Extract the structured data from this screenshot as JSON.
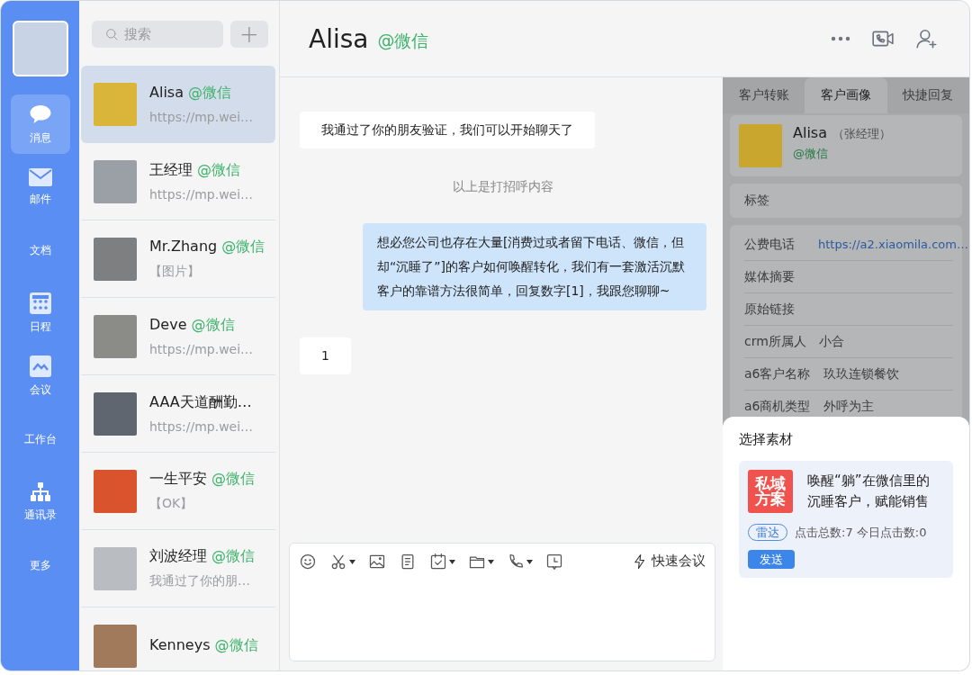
{
  "sidebar": {
    "items": [
      {
        "kind": "chat",
        "label": "消息",
        "selected": true
      },
      {
        "kind": "mail",
        "label": "邮件",
        "selected": false
      },
      {
        "kind": "text",
        "label": "文档",
        "selected": false
      },
      {
        "kind": "calendar",
        "label": "日程",
        "selected": false
      },
      {
        "kind": "gallery",
        "label": "会议",
        "selected": false
      },
      {
        "kind": "text",
        "label": "工作台",
        "selected": false
      },
      {
        "kind": "org",
        "label": "通讯录",
        "selected": false
      },
      {
        "kind": "text",
        "label": "更多",
        "selected": false
      }
    ]
  },
  "search": {
    "placeholder": "搜索"
  },
  "add_button": "+",
  "contacts": [
    {
      "name": "Alisa",
      "tag": "@微信",
      "preview": "https://mp.wei…",
      "selected": true
    },
    {
      "name": "王经理",
      "tag": "@微信",
      "preview": "https://mp.wei…",
      "selected": false
    },
    {
      "name": "Mr.Zhang",
      "tag": "@微信",
      "preview": "【图片】",
      "selected": false
    },
    {
      "name": "Deve",
      "tag": "@微信",
      "preview": "https://mp.wei…",
      "selected": false
    },
    {
      "name": "AAA天道酬勤…",
      "preview": "https://mp.wei…",
      "selected": false
    },
    {
      "name": "一生平安",
      "tag": "@微信",
      "preview": "【OK】",
      "selected": false
    },
    {
      "name": "刘波经理",
      "tag": "@微信",
      "preview": "我通过了你的朋…",
      "selected": false
    },
    {
      "name": "Kenneys",
      "tag": "@微信",
      "selected": false
    }
  ],
  "chat": {
    "title": "Alisa",
    "tag": "@微信",
    "messages": [
      {
        "kind": "incoming",
        "text": "我通过了你的朋友验证，我们可以开始聊天了"
      },
      {
        "kind": "system",
        "text": "以上是打招呼内容"
      },
      {
        "kind": "outgoing",
        "text": "想必您公司也存在大量[消费过或者留下电话、微信，但却“沉睡了”]的客户如何唤醒转化，我们有一套激活沉默客户的靠谱方法很简单，回复数字[1]，我跟您聊聊~"
      },
      {
        "kind": "incoming",
        "text": "1"
      }
    ],
    "toolbar": [
      {
        "kind": "emoji",
        "menu": false
      },
      {
        "kind": "scissors",
        "menu": true
      },
      {
        "kind": "image",
        "menu": false
      },
      {
        "kind": "document",
        "menu": false
      },
      {
        "kind": "task",
        "menu": true
      },
      {
        "kind": "folder",
        "menu": true
      },
      {
        "kind": "phone",
        "menu": true
      },
      {
        "kind": "clock",
        "menu": false
      }
    ],
    "quick_meeting": "快速会议"
  },
  "panel": {
    "tabs": [
      {
        "label": "客户转账",
        "selected": false
      },
      {
        "label": "客户画像",
        "selected": true
      },
      {
        "label": "快捷回复",
        "selected": false
      }
    ],
    "profile": {
      "name": "Alisa",
      "note": "（张经理）",
      "tag": "@微信"
    },
    "tags_label": "标签",
    "fields": [
      {
        "label": "公费电话",
        "value": "https://a2.xiaomila.com…",
        "kind": "link"
      },
      {
        "label": "媒体摘要"
      },
      {
        "label": "原始链接"
      },
      {
        "label": "crm所属人",
        "value": "小合",
        "kind": "text"
      },
      {
        "label": "a6客户名称",
        "value": "玖玖连锁餐饮",
        "kind": "text"
      },
      {
        "label": "a6商机类型",
        "value": "外呼为主",
        "kind": "text"
      }
    ]
  },
  "material_sheet": {
    "title": "选择素材",
    "thumbnail": "私域方案",
    "headline": "唤醒“躺”在微信里的沉睡客户，赋能销售",
    "badge": "雷达",
    "stats": "点击总数:7 今日点击数:0",
    "send": "发送"
  }
}
